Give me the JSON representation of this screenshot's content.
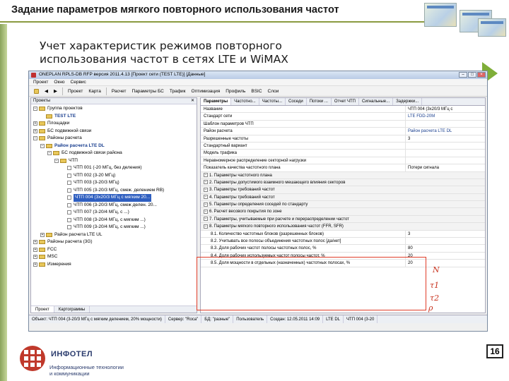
{
  "slide": {
    "title": "Задание параметров мягкого повторного использования частот",
    "subtitle_line1": "Учет характеристик режимов повторного",
    "subtitle_line2": "использования частот в сетях LTE и WiMAX",
    "page_number": "16",
    "logo_name": "ИНФОТЕЛ",
    "logo_sub1": "Информационные технологии",
    "logo_sub2": "и коммуникации",
    "colors": {
      "accent": "#8a9a40",
      "arrow": "#7fae39",
      "symbols": "#c8321e"
    }
  },
  "app": {
    "window_title": "ONEPLAN RPLS-DB RFP версия 2011.4.13 [Проект сети (TEST LTE)] [Данные]",
    "menu": [
      "Проект",
      "Окно",
      "Сервис"
    ],
    "toolbar": [
      "Проект",
      "Карта",
      "Расчет",
      "Параметры БС",
      "Трафик",
      "Оптимизация",
      "Профиль",
      "BSIC",
      "Слои"
    ],
    "left_pane_header": "Проекты",
    "left_pane_close": "✕",
    "tree": [
      {
        "label": "Группа проектов",
        "level": 0,
        "exp": "−",
        "icon": "folder",
        "bold": false
      },
      {
        "label": "TEST LTE",
        "level": 1,
        "exp": "",
        "icon": "folder",
        "bold": true
      },
      {
        "label": "Площадки",
        "level": 0,
        "exp": "+",
        "icon": "folder",
        "bold": false
      },
      {
        "label": "БС подвижной связи",
        "level": 0,
        "exp": "+",
        "icon": "folder",
        "bold": false
      },
      {
        "label": "Районы расчета",
        "level": 0,
        "exp": "−",
        "icon": "folder",
        "bold": false
      },
      {
        "label": "Район расчета LTE DL",
        "level": 1,
        "exp": "−",
        "icon": "folder",
        "bold": true
      },
      {
        "label": "БС подвижной связи района",
        "level": 2,
        "exp": "−",
        "icon": "folder",
        "bold": false
      },
      {
        "label": "ЧТП",
        "level": 3,
        "exp": "−",
        "icon": "folder",
        "bold": false
      },
      {
        "label": "ЧТП 001 (-20 МГц, без деления)",
        "level": 4,
        "exp": "",
        "icon": "leaf",
        "bold": false
      },
      {
        "label": "ЧТП 002 (3-20 МГц)",
        "level": 4,
        "exp": "",
        "icon": "leaf",
        "bold": false
      },
      {
        "label": "ЧТП 003 (3-20/3 МГц)",
        "level": 4,
        "exp": "",
        "icon": "leaf",
        "bold": false
      },
      {
        "label": "ЧТП 005 (3-20/3 МГц, смеж. делением RB)",
        "level": 4,
        "exp": "",
        "icon": "leaf",
        "bold": false
      },
      {
        "label": "ЧТП 004 (3x20/3 МГц с мягким 20...",
        "level": 4,
        "exp": "",
        "icon": "leaf",
        "bold": false,
        "selected": true
      },
      {
        "label": "ЧТП 006 (3-20/3 МГц, смеж делен. 20...",
        "level": 4,
        "exp": "",
        "icon": "leaf",
        "bold": false
      },
      {
        "label": "ЧТП 007 (3-20/4 МГц, с ...)",
        "level": 4,
        "exp": "",
        "icon": "leaf",
        "bold": false
      },
      {
        "label": "ЧТП 008 (3-20/4 МГц, с мягким ...)",
        "level": 4,
        "exp": "",
        "icon": "leaf",
        "bold": false
      },
      {
        "label": "ЧТП 009 (3-20/4 МГц, с мягким ...)",
        "level": 4,
        "exp": "",
        "icon": "leaf",
        "bold": false
      },
      {
        "label": "Район расчета LTE UL",
        "level": 1,
        "exp": "+",
        "icon": "folder",
        "bold": false
      },
      {
        "label": "Районы расчета (3G)",
        "level": 0,
        "exp": "+",
        "icon": "folder",
        "bold": false
      },
      {
        "label": "FCC",
        "level": 0,
        "exp": "+",
        "icon": "folder",
        "bold": false
      },
      {
        "label": "MSC",
        "level": 0,
        "exp": "+",
        "icon": "folder",
        "bold": false
      },
      {
        "label": "Измерения",
        "level": 0,
        "exp": "+",
        "icon": "folder",
        "bold": false
      }
    ],
    "left_tabs": [
      "Проект",
      "Картограммы"
    ],
    "right_tabs": [
      "Параметры",
      "Частотно...",
      "Частоты...",
      "Соседи",
      "Потоки ...",
      "Отчет ЧТП",
      "Сигнальные...",
      "Задержки..."
    ],
    "properties": [
      {
        "name": "Название",
        "value": "ЧТП 004 (3x20/3 МГц с",
        "type": "row",
        "blue": false
      },
      {
        "name": "Стандарт сети",
        "value": "LTE FDD-20M",
        "type": "row",
        "blue": true
      },
      {
        "name": "Шаблон параметров ЧТП",
        "value": "",
        "type": "row",
        "blue": false
      },
      {
        "name": "Район расчета",
        "value": "Район расчета LTE DL",
        "type": "row",
        "blue": true
      },
      {
        "name": "Разрешенные частоты",
        "value": "3",
        "type": "row",
        "blue": false
      },
      {
        "name": "Стандартный вариант",
        "value": "",
        "type": "row",
        "blue": false
      },
      {
        "name": "Модель трафика",
        "value": "",
        "type": "row",
        "blue": false
      },
      {
        "name": "Неравномерное распределение секторной нагрузки",
        "value": "",
        "type": "row",
        "blue": false
      },
      {
        "name": "Показатель качества частотного плана",
        "value": "Потери сигнала",
        "type": "row",
        "blue": false
      },
      {
        "name": "1. Параметры частотного плана",
        "value": "",
        "type": "group"
      },
      {
        "name": "2. Параметры допустимого взаимного мешающего влияния секторов",
        "value": "",
        "type": "group"
      },
      {
        "name": "3. Параметры требований частот",
        "value": "",
        "type": "group"
      },
      {
        "name": "4. Параметры требований частот",
        "value": "",
        "type": "group"
      },
      {
        "name": "5. Параметры определения соседей по стандарту",
        "value": "",
        "type": "group"
      },
      {
        "name": "6. Расчет весового покрытия по зоне",
        "value": "",
        "type": "group"
      },
      {
        "name": "7. Параметры, учитываемые при расчете и перераспределении частот",
        "value": "",
        "type": "group"
      },
      {
        "name": "8. Параметры мягкого повторного использования частот (FFR, SFR)",
        "value": "",
        "type": "group"
      },
      {
        "name": "8.1. Количество частотных блоков (разрешенных блоков)",
        "value": "3",
        "type": "sub"
      },
      {
        "name": "8.2. Учитывать все полосы объединения частотных полос [да/нет]",
        "value": "",
        "type": "sub"
      },
      {
        "name": "8.3. Доля рабочих частот полосы частотных полос, %",
        "value": "80",
        "type": "sub"
      },
      {
        "name": "8.4. Доля рабочих используемых частот полосы частот, %",
        "value": "20",
        "type": "sub"
      },
      {
        "name": "8.5. Доля мощности в отдельных (назначенных) частотных полосах, %",
        "value": "20",
        "type": "sub"
      }
    ],
    "status": [
      "Объект: ЧТП 004 (3-20/3 МГц с мягким делением, 20% мощности)",
      "Сервер: \"Roca\"",
      "БД: \"разные\"",
      "Пользователь",
      "Создан: 12.05.2011 14:09",
      "LTE DL",
      "ЧТП 004 (3-20"
    ]
  },
  "symbols": [
    "N",
    "τ1",
    "τ2",
    "ρ"
  ]
}
